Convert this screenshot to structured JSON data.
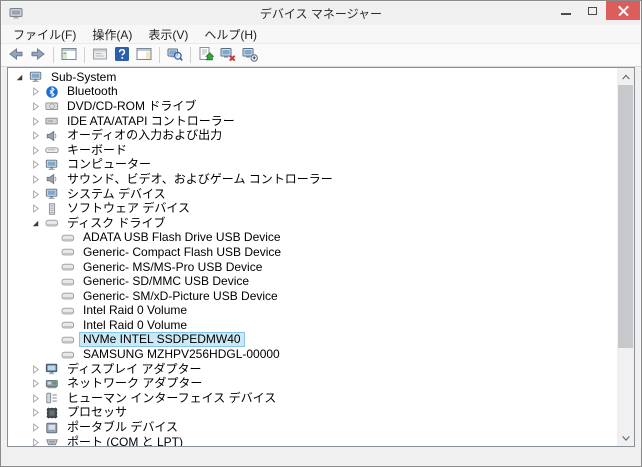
{
  "window": {
    "title": "デバイス マネージャー",
    "app_icon": "device-manager"
  },
  "menu": {
    "items": [
      {
        "label": "ファイル(F)"
      },
      {
        "label": "操作(A)"
      },
      {
        "label": "表示(V)"
      },
      {
        "label": "ヘルプ(H)"
      }
    ]
  },
  "toolbar": {
    "buttons": [
      {
        "icon": "back-arrow"
      },
      {
        "icon": "forward-arrow"
      },
      {
        "separator": true
      },
      {
        "icon": "console-tree-toggle"
      },
      {
        "separator": true
      },
      {
        "icon": "properties-window"
      },
      {
        "icon": "help"
      },
      {
        "icon": "action-pane-toggle"
      },
      {
        "separator": true
      },
      {
        "icon": "scan-hardware-changes"
      },
      {
        "separator": true
      },
      {
        "icon": "update-driver"
      },
      {
        "icon": "uninstall-device"
      },
      {
        "icon": "disable-device"
      }
    ]
  },
  "tree": {
    "items": [
      {
        "label": "Sub-System",
        "level": 0,
        "icon": "computer",
        "expander": "expanded",
        "selected": false
      },
      {
        "label": "Bluetooth",
        "level": 1,
        "icon": "bluetooth",
        "expander": "collapsed",
        "selected": false
      },
      {
        "label": "DVD/CD-ROM ドライブ",
        "level": 1,
        "icon": "dvd-drive",
        "expander": "collapsed",
        "selected": false
      },
      {
        "label": "IDE ATA/ATAPI コントローラー",
        "level": 1,
        "icon": "ide-controller",
        "expander": "collapsed",
        "selected": false
      },
      {
        "label": "オーディオの入力および出力",
        "level": 1,
        "icon": "audio",
        "expander": "collapsed",
        "selected": false
      },
      {
        "label": "キーボード",
        "level": 1,
        "icon": "keyboard",
        "expander": "collapsed",
        "selected": false
      },
      {
        "label": "コンピューター",
        "level": 1,
        "icon": "computer",
        "expander": "collapsed",
        "selected": false
      },
      {
        "label": "サウンド、ビデオ、およびゲーム コントローラー",
        "level": 1,
        "icon": "audio",
        "expander": "collapsed",
        "selected": false
      },
      {
        "label": "システム デバイス",
        "level": 1,
        "icon": "computer",
        "expander": "collapsed",
        "selected": false
      },
      {
        "label": "ソフトウェア デバイス",
        "level": 1,
        "icon": "software-device",
        "expander": "collapsed",
        "selected": false
      },
      {
        "label": "ディスク ドライブ",
        "level": 1,
        "icon": "disk-drive",
        "expander": "expanded",
        "selected": false
      },
      {
        "label": "ADATA USB Flash Drive USB Device",
        "level": 2,
        "icon": "disk-drive",
        "expander": "none",
        "selected": false
      },
      {
        "label": "Generic- Compact Flash USB Device",
        "level": 2,
        "icon": "disk-drive",
        "expander": "none",
        "selected": false
      },
      {
        "label": "Generic- MS/MS-Pro USB Device",
        "level": 2,
        "icon": "disk-drive",
        "expander": "none",
        "selected": false
      },
      {
        "label": "Generic- SD/MMC USB Device",
        "level": 2,
        "icon": "disk-drive",
        "expander": "none",
        "selected": false
      },
      {
        "label": "Generic- SM/xD-Picture USB Device",
        "level": 2,
        "icon": "disk-drive",
        "expander": "none",
        "selected": false
      },
      {
        "label": "Intel Raid 0 Volume",
        "level": 2,
        "icon": "disk-drive",
        "expander": "none",
        "selected": false
      },
      {
        "label": "Intel Raid 0 Volume",
        "level": 2,
        "icon": "disk-drive",
        "expander": "none",
        "selected": false
      },
      {
        "label": "NVMe INTEL SSDPEDMW40",
        "level": 2,
        "icon": "disk-drive",
        "expander": "none",
        "selected": true
      },
      {
        "label": "SAMSUNG MZHPV256HDGL-00000",
        "level": 2,
        "icon": "disk-drive",
        "expander": "none",
        "selected": false
      },
      {
        "label": "ディスプレイ アダプター",
        "level": 1,
        "icon": "display-adapter",
        "expander": "collapsed",
        "selected": false
      },
      {
        "label": "ネットワーク アダプター",
        "level": 1,
        "icon": "network-adapter",
        "expander": "collapsed",
        "selected": false
      },
      {
        "label": "ヒューマン インターフェイス デバイス",
        "level": 1,
        "icon": "hid",
        "expander": "collapsed",
        "selected": false
      },
      {
        "label": "プロセッサ",
        "level": 1,
        "icon": "processor",
        "expander": "collapsed",
        "selected": false
      },
      {
        "label": "ポータブル デバイス",
        "level": 1,
        "icon": "portable-device",
        "expander": "collapsed",
        "selected": false
      },
      {
        "label": "ポート (COM と LPT)",
        "level": 1,
        "icon": "port",
        "expander": "collapsed",
        "selected": false
      }
    ]
  },
  "colors": {
    "selection_bg": "#cbe8f6",
    "selection_border": "#85c5ea",
    "close_button_red": "#dd5c5c",
    "help_icon_blue": "#2b5fae",
    "titlebar_bg": "#f0f0f0"
  }
}
